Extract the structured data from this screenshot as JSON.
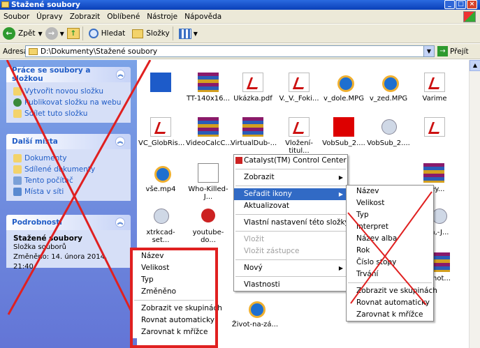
{
  "window": {
    "title": "Stažené soubory",
    "controls": [
      "_",
      "□",
      "×"
    ]
  },
  "menubar": [
    "Soubor",
    "Úpravy",
    "Zobrazit",
    "Oblíbené",
    "Nástroje",
    "Nápověda"
  ],
  "toolbar": {
    "back": "Zpět",
    "search": "Hledat",
    "folders": "Složky"
  },
  "address": {
    "label": "Adresa",
    "value": "D:\\Dokumenty\\Stažené soubory",
    "go": "Přejít"
  },
  "tasks": {
    "title": "Práce se soubory a složkou",
    "items": [
      "Vytvořit novou složku",
      "Publikovat složku na webu",
      "Sdílet tuto složku"
    ]
  },
  "places": {
    "title": "Další místa",
    "items": [
      "Dokumenty",
      "Sdílené dokumenty",
      "Tento počítač",
      "Místa v síti"
    ]
  },
  "details": {
    "title": "Podrobnosti",
    "name": "Stažené soubory",
    "type": "Složka souborů",
    "modified": "Změněno: 14. února 2014, 21:40"
  },
  "files": [
    {
      "label": "",
      "icon": "blue"
    },
    {
      "label": "TT-140x16...",
      "icon": "rar"
    },
    {
      "label": "Ukázka.pdf",
      "icon": "pdf"
    },
    {
      "label": "V._V._Foki...",
      "icon": "pdf"
    },
    {
      "label": "v_dole.MPG",
      "icon": "mpg"
    },
    {
      "label": "v_zed.MPG",
      "icon": "mpg"
    },
    {
      "label": "Varime",
      "icon": "pdf"
    },
    {
      "label": "VC_GlobRis...",
      "icon": "pdf"
    },
    {
      "label": "VideoCalcC...",
      "icon": "rar"
    },
    {
      "label": "VirtualDub-...",
      "icon": "rar"
    },
    {
      "label": "Vložení-titul...",
      "icon": "pdf"
    },
    {
      "label": "VobSub_2....",
      "icon": "red"
    },
    {
      "label": "VobSub_2....",
      "icon": "disk"
    },
    {
      "label": "",
      "icon": "pdf"
    },
    {
      "label": "vše.mp4",
      "icon": "mpg"
    },
    {
      "label": "Who-Killed-J...",
      "icon": "doc"
    },
    {
      "label": "xtrkcad-set...",
      "icon": "disk"
    },
    {
      "label": "youtube-do...",
      "icon": "redcirc"
    },
    {
      "label": "Život-na-zá...",
      "icon": "mpg"
    },
    {
      "label": "skey...",
      "icon": "rar"
    },
    {
      "label": "in,-J...",
      "icon": "disk"
    },
    {
      "label": "Phot...",
      "icon": "rar"
    }
  ],
  "context_menu": {
    "items": [
      "Catalyst(TM) Control Center",
      "Zobrazit",
      "Seřadit ikony",
      "Aktualizovat",
      "Vlastní nastavení této složky...",
      "Vložit",
      "Vložit zástupce",
      "Nový",
      "Vlastnosti"
    ]
  },
  "submenu": {
    "items": [
      "Název",
      "Velikost",
      "Typ",
      "Interpret",
      "Název alba",
      "Rok",
      "Číslo stopy",
      "Trvání",
      "Zobrazit ve skupinách",
      "Rovnat automaticky",
      "Zarovnat k mřížce"
    ]
  },
  "boxed_menu": {
    "items": [
      "Název",
      "Velikost",
      "Typ",
      "Změněno",
      "Zobrazit ve skupinách",
      "Rovnat automaticky",
      "Zarovnat k mřížce"
    ]
  },
  "colors": {
    "xp_blue": "#0a3fb8",
    "annotation_red": "#e02020",
    "menu_highlight": "#316ac5"
  }
}
